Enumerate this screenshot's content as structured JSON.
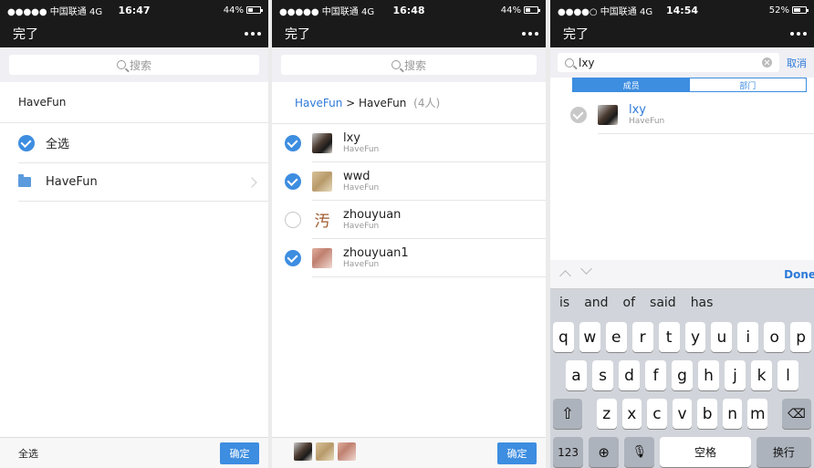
{
  "status_bars": [
    {
      "carrier": "●●●●● 中国联通 4G",
      "time": "16:47",
      "battery": "44%",
      "battery_level": 0.44
    },
    {
      "carrier": "●●●●● 中国联通 4G",
      "time": "16:48",
      "battery": "44%",
      "battery_level": 0.44
    },
    {
      "carrier": "●●●●○ 中国联通 4G",
      "time": "14:54",
      "battery": "52%",
      "battery_level": 0.52
    }
  ],
  "nav": {
    "done_label": "完了"
  },
  "search": {
    "placeholder": "搜索"
  },
  "screen1": {
    "section_title": "HaveFun",
    "select_all": "全选",
    "folder_name": "HaveFun",
    "bottom_select_all": "全选",
    "confirm": "确定"
  },
  "screen2": {
    "crumb_root": "HaveFun",
    "crumb_sep": " > ",
    "crumb_current": "HaveFun",
    "crumb_count": "(4人)",
    "members": [
      {
        "name": "lxy",
        "org": "HaveFun",
        "checked": true,
        "avatar": "photo"
      },
      {
        "name": "wwd",
        "org": "HaveFun",
        "checked": true,
        "avatar": "photo"
      },
      {
        "name": "zhouyuan",
        "org": "HaveFun",
        "checked": false,
        "avatar_text": "汚"
      },
      {
        "name": "zhouyuan1",
        "org": "HaveFun",
        "checked": true,
        "avatar": "photo"
      }
    ],
    "confirm": "确定"
  },
  "screen3": {
    "search_value": "lxy",
    "cancel": "取消",
    "seg_members": "成员",
    "seg_departments": "部门",
    "result": {
      "name": "lxy",
      "org": "HaveFun"
    },
    "keyboard": {
      "done": "Done",
      "suggestions": [
        "is",
        "and",
        "of",
        "said",
        "has"
      ],
      "row1": [
        "q",
        "w",
        "e",
        "r",
        "t",
        "y",
        "u",
        "i",
        "o",
        "p"
      ],
      "row2": [
        "a",
        "s",
        "d",
        "f",
        "g",
        "h",
        "j",
        "k",
        "l"
      ],
      "row3": [
        "z",
        "x",
        "c",
        "v",
        "b",
        "n",
        "m"
      ],
      "numbers": "123",
      "space": "空格",
      "return": "换行"
    }
  },
  "colors": {
    "accent": "#3d8de0",
    "bar": "#1a1a1a",
    "link": "#2e7ad8"
  }
}
